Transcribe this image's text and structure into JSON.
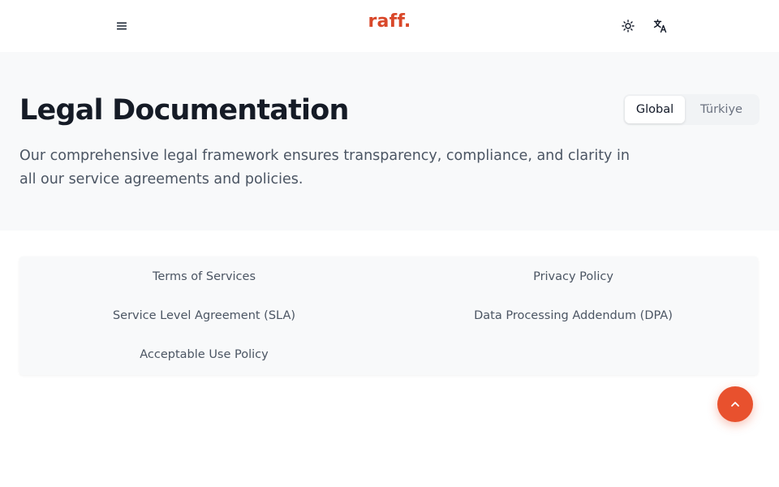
{
  "header": {
    "logo": "raff.",
    "menu_icon": "hamburger-menu-icon",
    "theme_icon": "sun-icon",
    "language_icon": "translate-icon"
  },
  "hero": {
    "title": "Legal Documentation",
    "description": "Our comprehensive legal framework ensures transparency, compliance, and clarity in all our service agreements and policies."
  },
  "region_toggle": {
    "options": [
      "Global",
      "Türkiye"
    ],
    "selected": "Global"
  },
  "documents": {
    "items": [
      "Terms of Services",
      "Privacy Policy",
      "Service Level Agreement (SLA)",
      "Data Processing Addendum (DPA)",
      "Acceptable Use Policy"
    ]
  },
  "scroll_top": {
    "icon": "chevron-up-icon"
  },
  "colors": {
    "brand": "#d9482a",
    "accent_button": "#e8512e",
    "hero_background": "#f8f9fa"
  }
}
